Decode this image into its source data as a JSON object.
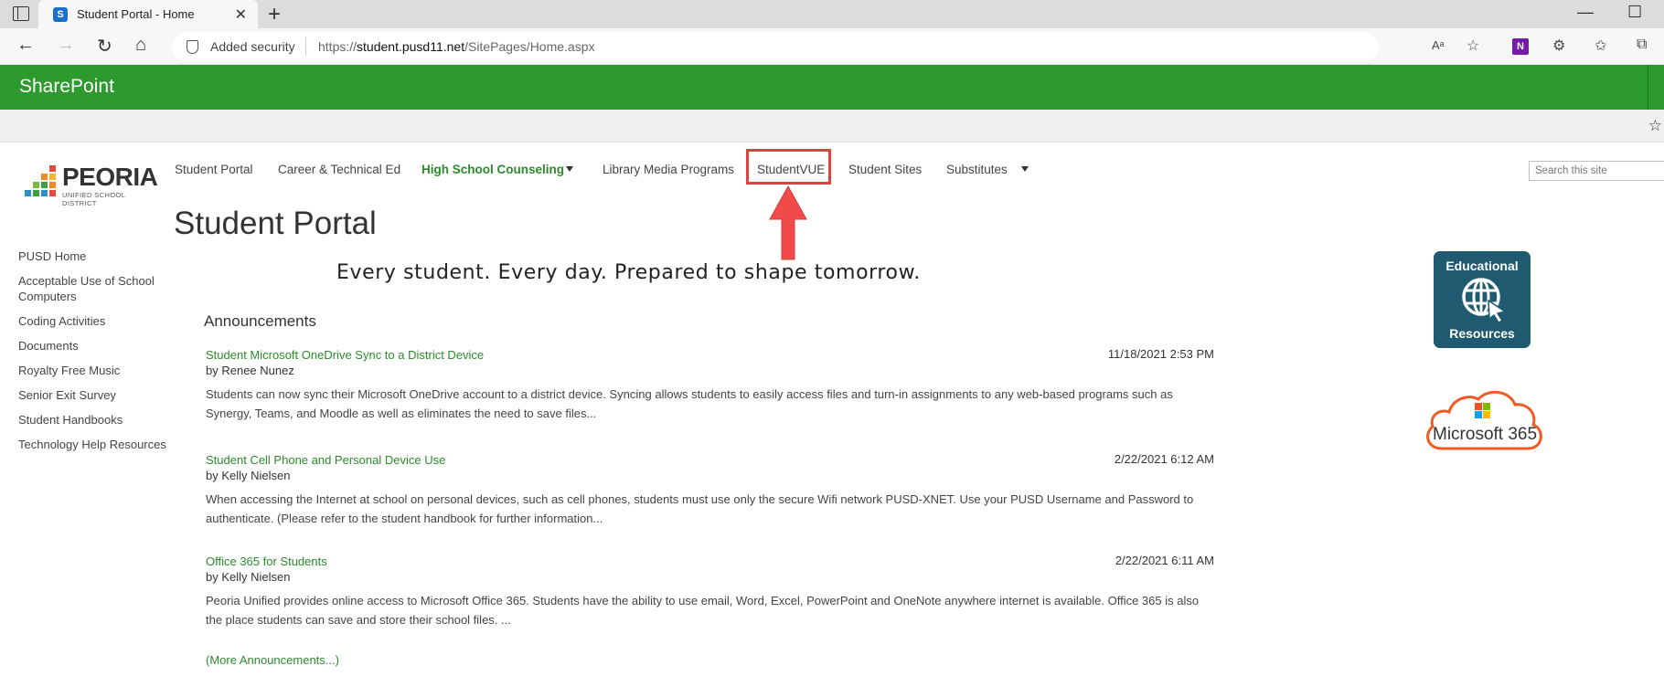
{
  "browser": {
    "tab_title": "Student Portal - Home",
    "security_label": "Added security",
    "url_prefix": "https://",
    "url_host": "student.pusd11.net",
    "url_path": "/SitePages/Home.aspx",
    "onenote_letter": "N"
  },
  "suitebar": {
    "title": "SharePoint"
  },
  "logo": {
    "word": "PEORIA",
    "subtitle": "UNIFIED SCHOOL DISTRICT"
  },
  "topnav": {
    "items": [
      {
        "label": "Student Portal"
      },
      {
        "label": "Career & Technical Ed"
      },
      {
        "label": "High School Counseling",
        "selected": true
      },
      {
        "label": "Library Media Programs"
      },
      {
        "label": "StudentVUE",
        "highlighted": true
      },
      {
        "label": "Student Sites"
      },
      {
        "label": "Substitutes"
      }
    ]
  },
  "search": {
    "placeholder": "Search this site"
  },
  "page": {
    "title": "Student Portal",
    "tagline": "Every student. Every day. Prepared to shape tomorrow."
  },
  "quicklaunch": {
    "items": [
      {
        "label": "PUSD Home"
      },
      {
        "label": "Acceptable Use of School Computers"
      },
      {
        "label": "Coding Activities"
      },
      {
        "label": "Documents"
      },
      {
        "label": "Royalty Free Music"
      },
      {
        "label": "Senior Exit Survey"
      },
      {
        "label": "Student Handbooks"
      },
      {
        "label": "Technology Help Resources"
      }
    ]
  },
  "announcements": {
    "heading": "Announcements",
    "items": [
      {
        "title": "Student Microsoft OneDrive Sync to a District Device",
        "author": "by Renee Nunez",
        "date": "11/18/2021 2:53 PM",
        "body": "Students can now sync their Microsoft OneDrive account to a district device. Syncing allows students to easily access files and turn-in assignments to any web-based programs such as Synergy, Teams, and Moodle as well as eliminates the need to save files..."
      },
      {
        "title": "Student Cell Phone and Personal Device Use",
        "author": "by Kelly Nielsen",
        "date": "2/22/2021 6:12 AM",
        "body": "When accessing the Internet at school on personal devices, such as cell phones, students must use only the secure Wifi network PUSD-XNET. Use your PUSD Username and Password to authenticate. (Please refer to the student handbook for further information..."
      },
      {
        "title": "Office 365 for Students",
        "author": "by Kelly Nielsen",
        "date": "2/22/2021 6:11 AM",
        "body": "Peoria Unified provides online access to Microsoft Office 365. Students have the ability to use email, Word, Excel, PowerPoint and OneNote anywhere internet is available. Office 365 is also the place students can save and store their school files. ..."
      }
    ],
    "more_label": "(More Announcements...)"
  },
  "tiles": {
    "educational": {
      "top": "Educational",
      "bottom": "Resources"
    },
    "m365": {
      "label": "Microsoft 365"
    }
  },
  "colors": {
    "suitebar": "#2c9a2c",
    "link_green": "#2c8a2c",
    "highlight_red": "#e0403f",
    "edu_tile": "#1f5a70"
  }
}
